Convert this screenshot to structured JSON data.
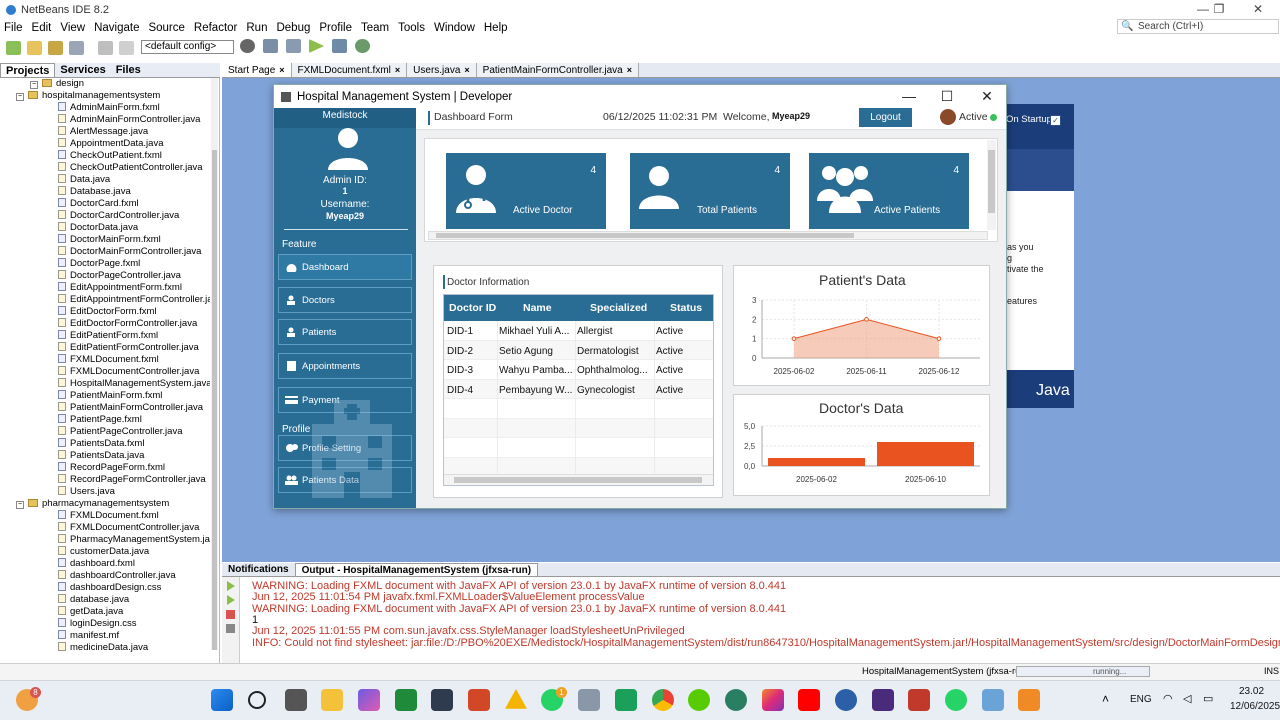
{
  "ide": {
    "title": "NetBeans IDE 8.2",
    "menu": [
      "File",
      "Edit",
      "View",
      "Navigate",
      "Source",
      "Refactor",
      "Run",
      "Debug",
      "Profile",
      "Team",
      "Tools",
      "Window",
      "Help"
    ],
    "search_placeholder": "Search (Ctrl+I)",
    "config": "<default config>",
    "panel_tabs": [
      "Projects",
      "Services",
      "Files"
    ],
    "editor_tabs": [
      "Start Page",
      "FXMLDocument.fxml",
      "Users.java",
      "PatientMainFormController.java"
    ],
    "output_tabs": [
      "Notifications",
      "Output - HospitalManagementSystem (jfxsa-run)"
    ]
  },
  "tree": [
    {
      "level": 3,
      "type": "dir",
      "name": "design"
    },
    {
      "level": 2,
      "type": "dir",
      "name": "hospitalmanagementsystem"
    },
    {
      "level": 4,
      "type": "fxml",
      "name": "AdminMainForm.fxml"
    },
    {
      "level": 4,
      "type": "java",
      "name": "AdminMainFormController.java"
    },
    {
      "level": 4,
      "type": "java",
      "name": "AlertMessage.java"
    },
    {
      "level": 4,
      "type": "java",
      "name": "AppointmentData.java"
    },
    {
      "level": 4,
      "type": "fxml",
      "name": "CheckOutPatient.fxml"
    },
    {
      "level": 4,
      "type": "java",
      "name": "CheckOutPatientController.java"
    },
    {
      "level": 4,
      "type": "java",
      "name": "Data.java"
    },
    {
      "level": 4,
      "type": "java",
      "name": "Database.java"
    },
    {
      "level": 4,
      "type": "fxml",
      "name": "DoctorCard.fxml"
    },
    {
      "level": 4,
      "type": "java",
      "name": "DoctorCardController.java"
    },
    {
      "level": 4,
      "type": "java",
      "name": "DoctorData.java"
    },
    {
      "level": 4,
      "type": "fxml",
      "name": "DoctorMainForm.fxml"
    },
    {
      "level": 4,
      "type": "java",
      "name": "DoctorMainFormController.java"
    },
    {
      "level": 4,
      "type": "fxml",
      "name": "DoctorPage.fxml"
    },
    {
      "level": 4,
      "type": "java",
      "name": "DoctorPageController.java"
    },
    {
      "level": 4,
      "type": "fxml",
      "name": "EditAppointmentForm.fxml"
    },
    {
      "level": 4,
      "type": "java",
      "name": "EditAppointmentFormController.java"
    },
    {
      "level": 4,
      "type": "fxml",
      "name": "EditDoctorForm.fxml"
    },
    {
      "level": 4,
      "type": "java",
      "name": "EditDoctorFormController.java"
    },
    {
      "level": 4,
      "type": "fxml",
      "name": "EditPatientForm.fxml"
    },
    {
      "level": 4,
      "type": "java",
      "name": "EditPatientFormController.java"
    },
    {
      "level": 4,
      "type": "fxml",
      "name": "FXMLDocument.fxml"
    },
    {
      "level": 4,
      "type": "java",
      "name": "FXMLDocumentController.java"
    },
    {
      "level": 4,
      "type": "java",
      "name": "HospitalManagementSystem.java"
    },
    {
      "level": 4,
      "type": "fxml",
      "name": "PatientMainForm.fxml"
    },
    {
      "level": 4,
      "type": "java",
      "name": "PatientMainFormController.java"
    },
    {
      "level": 4,
      "type": "fxml",
      "name": "PatientPage.fxml"
    },
    {
      "level": 4,
      "type": "java",
      "name": "PatientPageController.java"
    },
    {
      "level": 4,
      "type": "fxml",
      "name": "PatientsData.fxml"
    },
    {
      "level": 4,
      "type": "java",
      "name": "PatientsData.java"
    },
    {
      "level": 4,
      "type": "fxml",
      "name": "RecordPageForm.fxml"
    },
    {
      "level": 4,
      "type": "java",
      "name": "RecordPageFormController.java"
    },
    {
      "level": 4,
      "type": "java",
      "name": "Users.java"
    },
    {
      "level": 2,
      "type": "dir",
      "name": "pharmacymanagementsystem"
    },
    {
      "level": 4,
      "type": "fxml",
      "name": "FXMLDocument.fxml"
    },
    {
      "level": 4,
      "type": "java",
      "name": "FXMLDocumentController.java"
    },
    {
      "level": 4,
      "type": "java",
      "name": "PharmacyManagementSystem.java"
    },
    {
      "level": 4,
      "type": "java",
      "name": "customerData.java"
    },
    {
      "level": 4,
      "type": "fxml",
      "name": "dashboard.fxml"
    },
    {
      "level": 4,
      "type": "java",
      "name": "dashboardController.java"
    },
    {
      "level": 4,
      "type": "css",
      "name": "dashboardDesign.css"
    },
    {
      "level": 4,
      "type": "java",
      "name": "database.java"
    },
    {
      "level": 4,
      "type": "java",
      "name": "getData.java"
    },
    {
      "level": 4,
      "type": "css",
      "name": "loginDesign.css"
    },
    {
      "level": 4,
      "type": "file",
      "name": "manifest.mf"
    },
    {
      "level": 4,
      "type": "java",
      "name": "medicineData.java"
    }
  ],
  "startpage": {
    "on_startup": "On Startup",
    "lines": [
      "as you",
      "g",
      "tivate the",
      "eatures"
    ],
    "java_label": "Java"
  },
  "app": {
    "title": "Hospital Management System | Developer",
    "brand": "Medistock",
    "admin_id_label": "Admin ID:",
    "admin_id": "1",
    "username_label": "Username:",
    "username": "Myeap29",
    "feature_label": "Feature",
    "profile_label": "Profile",
    "nav": [
      "Dashboard",
      "Doctors",
      "Patients",
      "Appointments",
      "Payment"
    ],
    "profile_nav": [
      "Profile Setting",
      "Patients Data"
    ],
    "header_title": "Dashboard Form",
    "datetime": "06/12/2025 11:02:31 PM",
    "welcome": "Welcome,",
    "logout": "Logout",
    "status": "Active",
    "cards": [
      {
        "label": "Active Doctor",
        "value": "4",
        "icon": "doctor-icon"
      },
      {
        "label": "Total Patients",
        "value": "4",
        "icon": "user-icon"
      },
      {
        "label": "Active Patients",
        "value": "4",
        "icon": "group-icon"
      }
    ],
    "doctor_info_title": "Doctor Information",
    "table": {
      "headers": [
        "Doctor ID",
        "Name",
        "Specialized",
        "Status"
      ],
      "rows": [
        [
          "DID-1",
          "Mikhael Yuli A...",
          "Allergist",
          "Active"
        ],
        [
          "DID-2",
          "Setio Agung",
          "Dermatologist",
          "Active"
        ],
        [
          "DID-3",
          "Wahyu Pamba...",
          "Ophthalmolog...",
          "Active"
        ],
        [
          "DID-4",
          "Pembayung W...",
          "Gynecologist",
          "Active"
        ]
      ]
    }
  },
  "chart_data": [
    {
      "type": "area",
      "title": "Patient's Data",
      "categories": [
        "2025-06-02",
        "2025-06-11",
        "2025-06-12"
      ],
      "values": [
        1,
        2,
        1
      ],
      "yticks": [
        "0",
        "1",
        "2",
        "3"
      ],
      "ylim": [
        0,
        3
      ],
      "color": "#f0a080"
    },
    {
      "type": "bar",
      "title": "Doctor's Data",
      "categories": [
        "2025-06-02",
        "2025-06-10"
      ],
      "values": [
        1,
        3
      ],
      "yticks": [
        "0,0",
        "2,5",
        "5,0"
      ],
      "ylim": [
        0,
        5
      ],
      "color": "#e8531f"
    }
  ],
  "output": [
    {
      "cls": "warn",
      "text": "WARNING: Loading FXML document with JavaFX API of version 23.0.1 by JavaFX runtime of version 8.0.441"
    },
    {
      "cls": "warn",
      "text": "Jun 12, 2025 11:01:54 PM javafx.fxml.FXMLLoader$ValueElement processValue"
    },
    {
      "cls": "warn",
      "text": "WARNING: Loading FXML document with JavaFX API of version 23.0.1 by JavaFX runtime of version 8.0.441"
    },
    {
      "cls": "plain",
      "text": "1"
    },
    {
      "cls": "warn",
      "text": "Jun 12, 2025 11:01:55 PM com.sun.javafx.css.StyleManager loadStylesheetUnPrivileged"
    },
    {
      "cls": "info",
      "text": "INFO: Could not find stylesheet: jar:file:/D:/PBO%20EXE/Medistock/HospitalManagementSystem/dist/run8647310/HospitalManagementSystem.jar!/HospitalManagementSystem/src/design/DoctorMainFormDesign.css"
    }
  ],
  "status": {
    "project": "HospitalManagementSystem (jfxsa-run)",
    "state": "running...",
    "ins": "INS"
  },
  "taskbar": {
    "badge_widgets": "8",
    "badge_whatsapp": "1",
    "lang": "ENG",
    "time": "23.02",
    "date": "12/06/2025"
  }
}
